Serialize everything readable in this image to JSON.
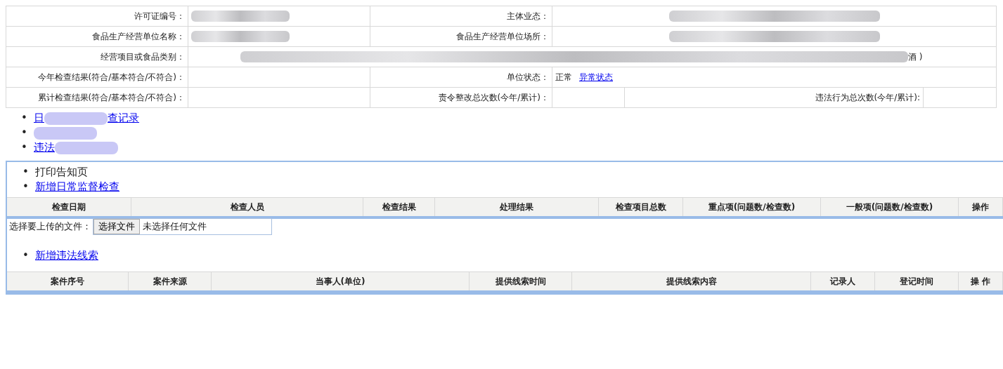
{
  "info_table": {
    "rows": [
      {
        "cells": [
          {
            "kind": "label",
            "text": "许可证编号："
          },
          {
            "kind": "redacted"
          },
          {
            "kind": "label",
            "text": "主体业态："
          },
          {
            "kind": "redacted"
          }
        ]
      },
      {
        "cells": [
          {
            "kind": "label",
            "text": "食品生产经营单位名称："
          },
          {
            "kind": "redacted"
          },
          {
            "kind": "label",
            "text": "食品生产经营单位场所："
          },
          {
            "kind": "redacted"
          }
        ]
      },
      {
        "cells": [
          {
            "kind": "label",
            "text": "经营项目或食品类别："
          },
          {
            "kind": "redacted_tail",
            "text": "酒 )"
          }
        ]
      },
      {
        "cells": [
          {
            "kind": "label",
            "text": "今年检查结果(符合/基本符合/不符合)："
          },
          {
            "kind": "empty"
          },
          {
            "kind": "label",
            "text": "单位状态："
          },
          {
            "kind": "status",
            "text": "正常",
            "link": "异常状态"
          }
        ]
      },
      {
        "cells": [
          {
            "kind": "label",
            "text": "累计检查结果(符合/基本符合/不符合)："
          },
          {
            "kind": "empty"
          },
          {
            "kind": "label",
            "text": "责令整改总次数(今年/累计)："
          },
          {
            "kind": "empty"
          },
          {
            "kind": "label",
            "text": "违法行为总次数(今年/累计):"
          },
          {
            "kind": "empty"
          }
        ]
      }
    ]
  },
  "nav_links": [
    {
      "bullet": "•",
      "prefix": "日",
      "text": "查记录"
    },
    {
      "bullet": "•"
    },
    {
      "bullet": "•",
      "prefix": "违法"
    }
  ],
  "inspection_panel": {
    "actions": [
      {
        "bullet": "•",
        "kind": "text",
        "text": "打印告知页"
      },
      {
        "bullet": "•",
        "kind": "link",
        "text": "新增日常监督检查"
      }
    ],
    "columns": [
      "检查日期",
      "检查人员",
      "检查结果",
      "处理结果",
      "检查项目总数",
      "重点项(问题数/检查数)",
      "一般项(问题数/检查数)",
      "操作"
    ]
  },
  "upload": {
    "label": "选择要上传的文件：",
    "button": "选择文件",
    "status": "未选择任何文件"
  },
  "clue_panel": {
    "actions": [
      {
        "bullet": "•",
        "kind": "link",
        "text": "新增违法线索"
      }
    ],
    "columns": [
      "案件序号",
      "案件来源",
      "当事人(单位)",
      "提供线索时间",
      "提供线索内容",
      "记录人",
      "登记时间",
      "操 作"
    ]
  }
}
